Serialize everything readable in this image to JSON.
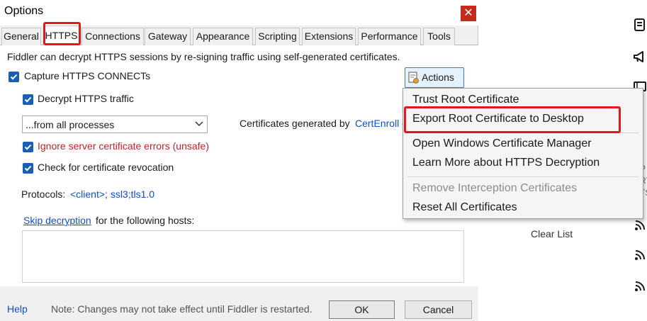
{
  "dialog": {
    "title": "Options",
    "close_icon": "close-icon",
    "tabs": [
      {
        "label": "General",
        "active": false
      },
      {
        "label": "HTTPS",
        "active": true
      },
      {
        "label": "Connections",
        "active": false
      },
      {
        "label": "Gateway",
        "active": false
      },
      {
        "label": "Appearance",
        "active": false
      },
      {
        "label": "Scripting",
        "active": false
      },
      {
        "label": "Extensions",
        "active": false
      },
      {
        "label": "Performance",
        "active": false
      },
      {
        "label": "Tools",
        "active": false
      }
    ],
    "https": {
      "intro": "Fiddler can decrypt HTTPS sessions by re-signing traffic using self-generated certificates.",
      "capture_connects": {
        "label": "Capture HTTPS CONNECTs",
        "checked": true
      },
      "decrypt_traffic": {
        "label": "Decrypt HTTPS traffic",
        "checked": true
      },
      "process_filter": {
        "selected": "...from all processes"
      },
      "certs_generated_label": "Certificates generated by",
      "certs_generated_value": "CertEnroll e",
      "ignore_errors": {
        "label": "Ignore server certificate errors (unsafe)",
        "checked": true
      },
      "check_revocation": {
        "label": "Check for certificate revocation",
        "checked": true
      },
      "protocols_label": "Protocols:",
      "protocols_value": "<client>; ssl3;tls1.0",
      "skip_link": "Skip decryption",
      "skip_rest": "for the following hosts:",
      "hosts_value": ""
    },
    "actions_button": {
      "label": "Actions"
    },
    "footer": {
      "help": "Help",
      "note": "Note: Changes may not take effect until Fiddler is restarted.",
      "ok": "OK",
      "cancel": "Cancel"
    }
  },
  "actions_menu": {
    "items": [
      {
        "label": "Trust Root Certificate",
        "enabled": true,
        "highlighted": false
      },
      {
        "label": "Export Root Certificate to Desktop",
        "enabled": true,
        "highlighted": true
      },
      {
        "label": "Open Windows Certificate Manager",
        "enabled": true,
        "highlighted": false
      },
      {
        "label": "Learn More about HTTPS Decryption",
        "enabled": true,
        "highlighted": false
      },
      {
        "label": "Remove Interception Certificates",
        "enabled": false,
        "highlighted": false
      },
      {
        "label": "Reset All Certificates",
        "enabled": true,
        "highlighted": false
      }
    ]
  },
  "background": {
    "clear_list": "Clear List",
    "cut_text": [
      "P",
      "RT",
      "TS"
    ],
    "icons": [
      "document-icon",
      "megaphone-icon",
      "film-icon",
      "feed-icon",
      "feed-icon",
      "feed-icon"
    ]
  },
  "colors": {
    "accent": "#1a5fb4",
    "link": "#0f4fc7",
    "warning_text": "#c8222d",
    "annotation": "#e3171d"
  }
}
